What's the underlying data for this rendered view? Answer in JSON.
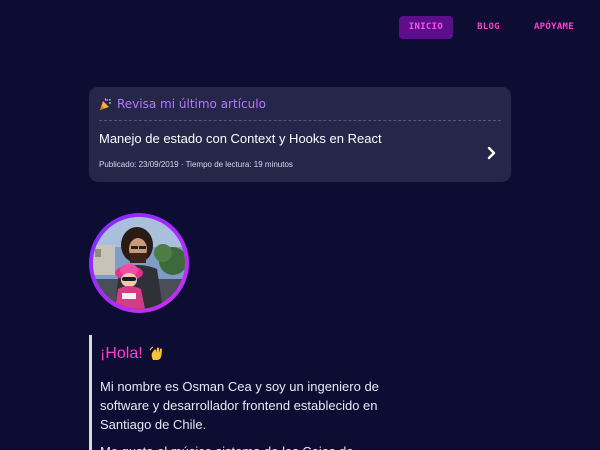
{
  "nav": {
    "items": [
      {
        "label": "INICIO",
        "active": true
      },
      {
        "label": "BLOG",
        "active": false
      },
      {
        "label": "APÓYAME",
        "active": false
      }
    ]
  },
  "latest_article": {
    "header": "Revisa mi último artículo",
    "title": "Manejo de estado con Context y Hooks en React",
    "meta": "Publicado: 23/09/2019 · Tiempo de lectura: 19 minutos",
    "header_icon": "party-popper-icon",
    "action_icon": "chevron-right-icon"
  },
  "avatar": {
    "description": "profile-photo"
  },
  "bio": {
    "greeting": "¡Hola!",
    "greeting_icon": "waving-hand-icon",
    "paragraph1": "Mi nombre es Osman Cea y soy un ingeniero de software y desarrollador frontend establecido en Santiago de Chile.",
    "paragraph2": "Me gusta el música sistema de las Cajas de"
  },
  "colors": {
    "background": "#0d0c33",
    "accent": "#ff3fd0",
    "card": "#25264a",
    "purple": "#b877ff"
  }
}
